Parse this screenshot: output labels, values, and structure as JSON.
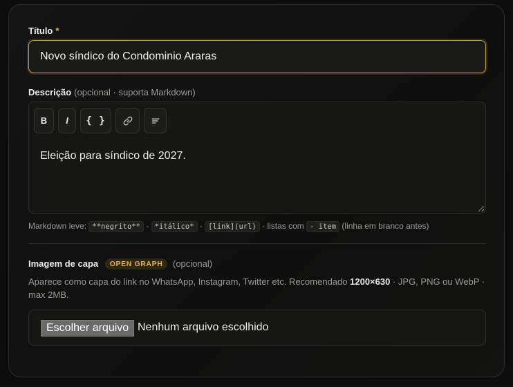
{
  "form": {
    "title": {
      "label": "Título",
      "required_mark": "*",
      "value": "Novo síndico do Condominio Araras"
    },
    "description": {
      "label": "Descrição",
      "note": "(opcional · suporta Markdown)",
      "toolbar": {
        "bold": "B",
        "italic": "I",
        "code": "{ }",
        "link_icon": "link-icon",
        "list_icon": "list-icon"
      },
      "value": "Eleição para síndico de 2027.",
      "hint": {
        "prefix": "Markdown leve:",
        "bold_syntax": "**negrito**",
        "sep1": "·",
        "italic_syntax": "*itálico*",
        "sep2": "·",
        "link_syntax": "[link](url)",
        "lists_text": "· listas com",
        "item_syntax": "- item",
        "suffix": "(linha em branco antes)"
      }
    },
    "cover": {
      "label": "Imagem de capa",
      "badge": "OPEN GRAPH",
      "note": "(opcional)",
      "desc_prefix": "Aparece como capa do link no WhatsApp, Instagram, Twitter etc. Recomendado",
      "desc_size": "1200×630",
      "desc_suffix": "· JPG, PNG ou WebP · max 2MB.",
      "file_button": "Escolher arquivo",
      "file_status": "Nenhum arquivo escolhido"
    }
  },
  "colors": {
    "accent": "#e3b341",
    "background": "#0c0c0c",
    "card": "#141414"
  }
}
